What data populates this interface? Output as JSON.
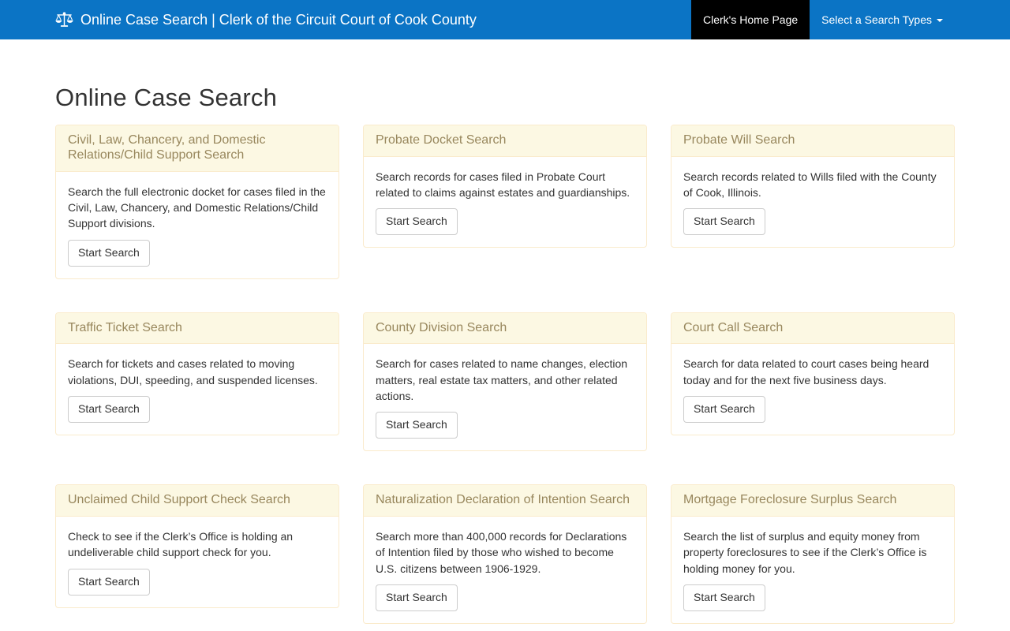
{
  "navbar": {
    "brand": "Online Case Search | Clerk of the Circuit Court of Cook County",
    "home_label": "Clerk's Home Page",
    "dropdown_label": "Select a Search Types"
  },
  "page": {
    "title": "Online Case Search"
  },
  "cards": [
    {
      "title": "Civil, Law, Chancery, and Domestic Relations/Child Support Search",
      "description": "Search the full electronic docket for cases filed in the Civil, Law, Chancery, and Domestic Relations/Child Support divisions.",
      "button_label": "Start Search"
    },
    {
      "title": "Probate Docket Search",
      "description": "Search records for cases filed in Probate Court related to claims against estates and guardianships.",
      "button_label": "Start Search"
    },
    {
      "title": "Probate Will Search",
      "description": "Search records related to Wills filed with the County of Cook, Illinois.",
      "button_label": "Start Search"
    },
    {
      "title": "Traffic Ticket Search",
      "description": "Search for tickets and cases related to moving violations, DUI, speeding, and suspended licenses.",
      "button_label": "Start Search"
    },
    {
      "title": "County Division Search",
      "description": "Search for cases related to name changes, election matters, real estate tax matters, and other related actions.",
      "button_label": "Start Search"
    },
    {
      "title": "Court Call Search",
      "description": "Search for data related to court cases being heard today and for the next five business days.",
      "button_label": "Start Search"
    },
    {
      "title": "Unclaimed Child Support Check Search",
      "description": "Check to see if the Clerk’s Office is holding an undeliverable child support check for you.",
      "button_label": "Start Search"
    },
    {
      "title": "Naturalization Declaration of Intention Search",
      "description": "Search more than 400,000 records for Declarations of Intention filed by those who wished to become U.S. citizens between 1906-1929.",
      "button_label": "Start Search"
    },
    {
      "title": "Mortgage Foreclosure Surplus Search",
      "description": "Search the list of surplus and equity money from property foreclosures to see if the Clerk’s Office is holding money for you.",
      "button_label": "Start Search"
    }
  ],
  "colors": {
    "navbar_bg": "#0b74c5",
    "navbar_active_bg": "#000000",
    "navbar_text": "#ffffff",
    "card_header_bg": "#fcf8e3",
    "card_border": "#faebcc",
    "card_header_text": "#98875d",
    "body_text": "#333333",
    "button_border": "#cccccc"
  }
}
